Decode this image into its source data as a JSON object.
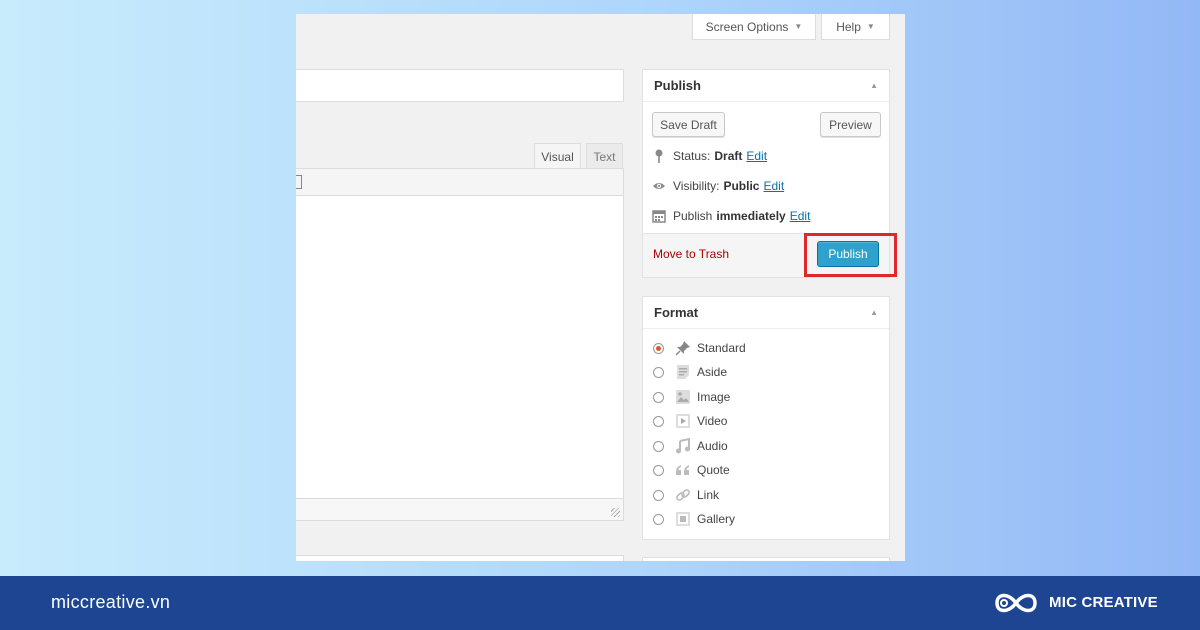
{
  "top_buttons": {
    "screen_options": "Screen Options",
    "help": "Help"
  },
  "editor_tabs": {
    "visual": "Visual",
    "text": "Text"
  },
  "publish_box": {
    "title": "Publish",
    "save_draft": "Save Draft",
    "preview": "Preview",
    "status_label": "Status:",
    "status_value": "Draft",
    "visibility_label": "Visibility:",
    "visibility_value": "Public",
    "publish_label": "Publish",
    "publish_value": "immediately",
    "edit": "Edit",
    "move_to_trash": "Move to Trash",
    "publish_button": "Publish"
  },
  "format_box": {
    "title": "Format",
    "selected": "Standard",
    "options": [
      {
        "label": "Standard",
        "icon": "pushpin-icon"
      },
      {
        "label": "Aside",
        "icon": "aside-icon"
      },
      {
        "label": "Image",
        "icon": "image-icon"
      },
      {
        "label": "Video",
        "icon": "video-icon"
      },
      {
        "label": "Audio",
        "icon": "audio-icon"
      },
      {
        "label": "Quote",
        "icon": "quote-icon"
      },
      {
        "label": "Link",
        "icon": "link-icon"
      },
      {
        "label": "Gallery",
        "icon": "gallery-icon"
      }
    ]
  },
  "footer": {
    "site": "miccreative.vn",
    "brand": "MIC CREATIVE"
  },
  "colors": {
    "bottom_bar": "#1d4592",
    "publish_button": "#2ea2cc",
    "highlight": "#e0282c",
    "trash_link": "#aa0000",
    "edit_link": "#0073aa"
  }
}
